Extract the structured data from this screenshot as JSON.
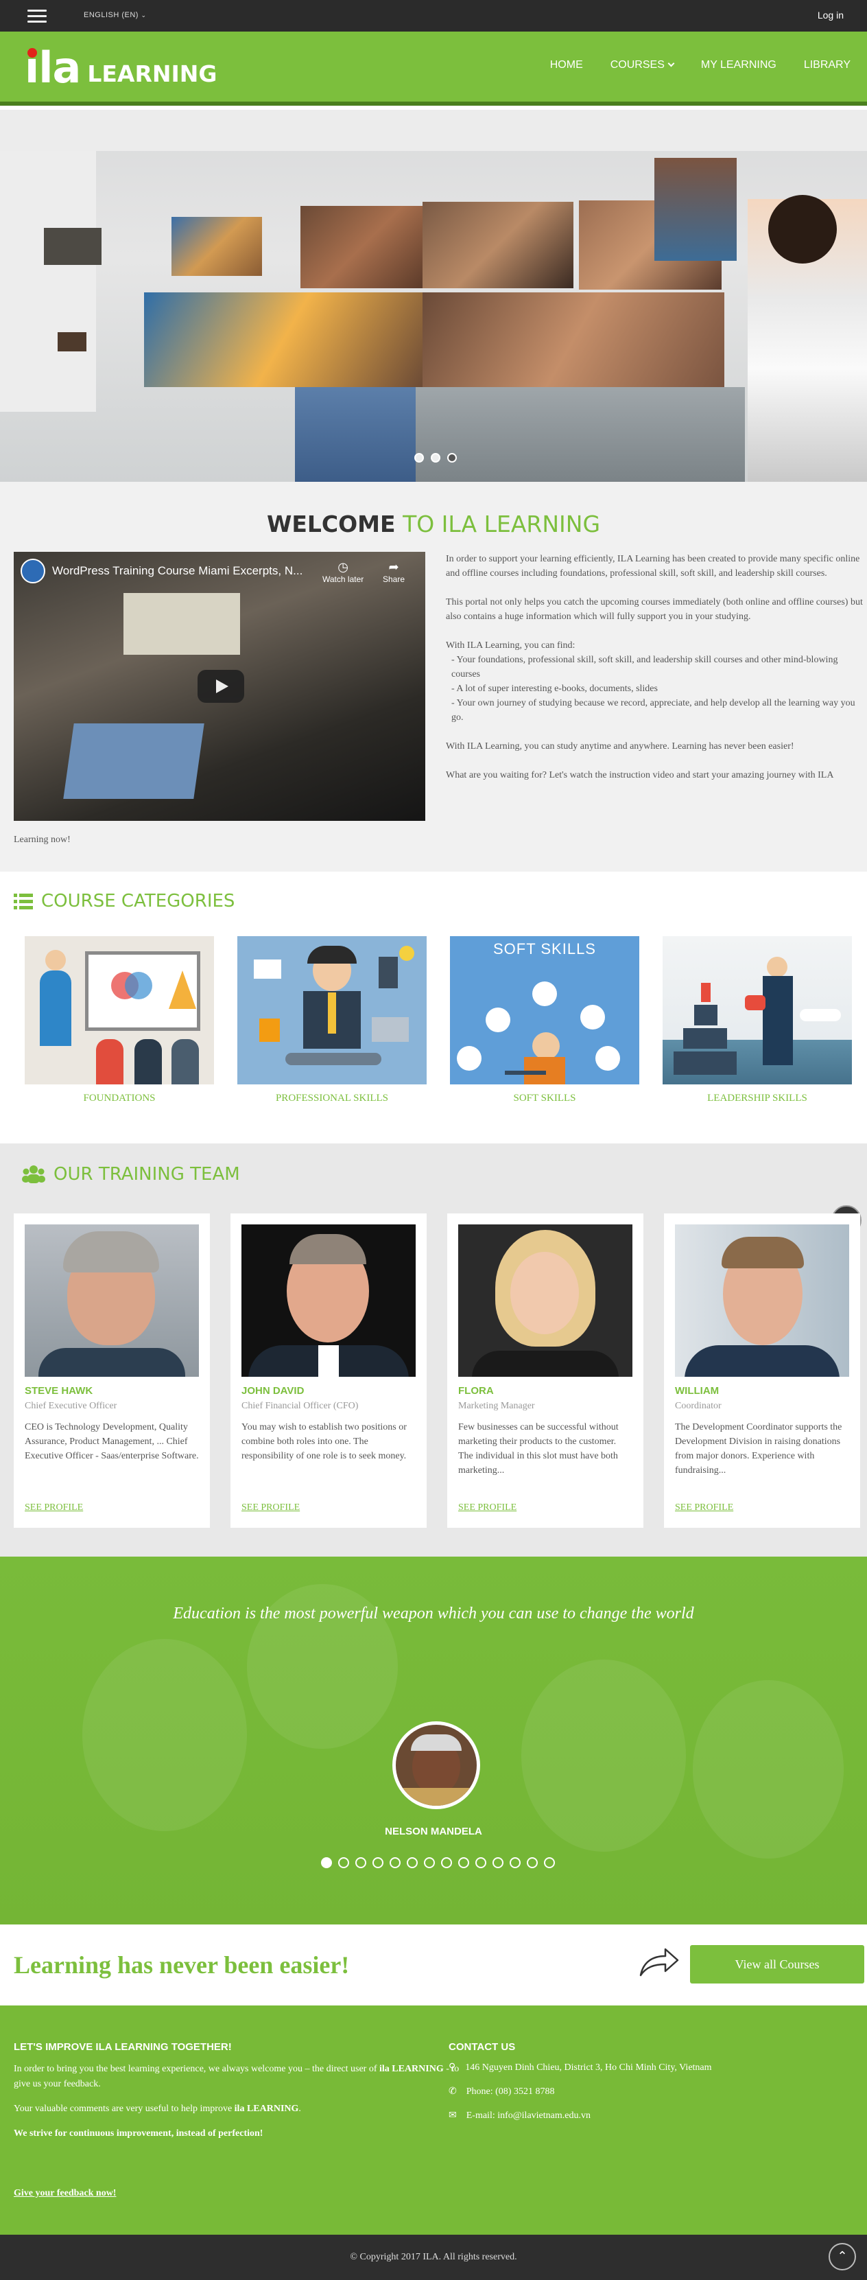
{
  "topbar": {
    "language": "ENGLISH (EN)",
    "login": "Log in"
  },
  "header": {
    "logo_ila": "ila",
    "logo_learning": "LEARNING",
    "nav": [
      "HOME",
      "COURSES",
      "MY LEARNING",
      "LIBRARY"
    ]
  },
  "hero": {
    "slides": 3,
    "active_slide": 3
  },
  "welcome": {
    "title_bold": "WELCOME",
    "title_green": "TO ILA LEARNING",
    "video_title": "WordPress Training Course Miami Excerpts, N...",
    "video_watch_later": "Watch later",
    "video_share": "Share",
    "paragraphs": [
      "In order to support your learning efficiently, ILA Learning has been created to provide many specific online and offline courses including foundations, professional skill, soft skill, and leadership skill courses.",
      "This portal not only helps you catch the upcoming courses immediately (both online and offline courses) but also contains a huge information which will fully support you in your studying.",
      "With ILA Learning, you can find:",
      "With ILA Learning, you can study anytime and anywhere. Learning has never been easier!",
      "What are you waiting for? Let's watch the instruction video and start your amazing journey with ILA"
    ],
    "find_items": [
      "- Your foundations, professional skill, soft skill, and leadership skill courses and other mind-blowing courses",
      "- A lot of super interesting e-books, documents, slides",
      "- Your own journey of studying because we record, appreciate, and help develop  all the learning way you go."
    ],
    "learning_now": "Learning now!"
  },
  "categories": {
    "title": "COURSE CATEGORIES",
    "items": [
      "FOUNDATIONS",
      "PROFESSIONAL SKILLS",
      "SOFT SKILLS",
      "LEADERSHIP SKILLS"
    ],
    "soft_skills_caption": "SOFT SKILLS"
  },
  "team": {
    "title": "OUR TRAINING TEAM",
    "see_profile": "SEE PROFILE",
    "members": [
      {
        "name": "STEVE HAWK",
        "role": "Chief Executive Officer",
        "desc": "CEO is Technology Development, Quality Assurance, Product Management, ... Chief Executive Officer - Saas/enterprise Software."
      },
      {
        "name": "JOHN DAVID",
        "role": "Chief Financial Officer (CFO)",
        "desc": "You may wish to establish two positions or combine both roles into one. The responsibility of one role is to seek money."
      },
      {
        "name": "FLORA",
        "role": "Marketing Manager",
        "desc": "Few businesses can be successful without marketing their products to the customer. The individual in this slot must have both marketing..."
      },
      {
        "name": "WILLIAM",
        "role": "Coordinator",
        "desc": "The Development Coordinator supports the Development Division in raising donations from major donors. Experience with fundraising..."
      }
    ]
  },
  "quote": {
    "text": "Education is the most powerful weapon which you can use to change the world",
    "author": "NELSON MANDELA",
    "dots": 14,
    "active_dot": 1
  },
  "cta": {
    "headline": "Learning has never been easier!",
    "button": "View all Courses"
  },
  "footer": {
    "left_title": "LET'S IMPROVE ILA LEARNING TOGETHER!",
    "p1_a": "In order to bring you the best learning experience, we always welcome you – the direct user of ",
    "p1_b": "ila LEARNING",
    "p1_c": " - to give us your feedback.",
    "p2_a": "Your valuable comments are very useful to help improve ",
    "p2_b": "ila LEARNING",
    "p2_c": ".",
    "p3": "We strive for continuous improvement, instead of perfection!",
    "feedback": "Give your feedback now!",
    "contact_title": "CONTACT US",
    "address": "146 Nguyen Dinh Chieu, District 3, Ho Chi Minh City, Vietnam",
    "phone": "Phone: (08) 3521 8788",
    "email": "E-mail: info@ilavietnam.edu.vn"
  },
  "copyright": "© Copyright 2017 ILA. All rights reserved.",
  "colors": {
    "brand_green": "#7cbf3d",
    "dark": "#2b2b2b",
    "logo_dot": "#e2231a"
  }
}
